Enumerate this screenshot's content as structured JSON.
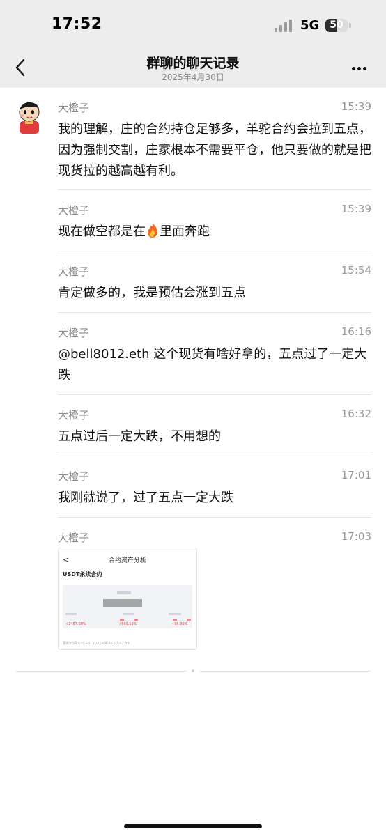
{
  "status_bar": {
    "time": "17:52",
    "network": "5G",
    "battery": "50",
    "battery_level": 0.5
  },
  "header": {
    "title": "群聊的聊天记录",
    "subtitle": "2025年4月30日"
  },
  "messages": [
    {
      "sender": "大橙子",
      "time": "15:39",
      "text": "我的理解，庄的合约持仓足够多，羊驼合约会拉到五点，因为强制交割，庄家根本不需要平仓，他只要做的就是把现货拉的越高越有利。"
    },
    {
      "sender": "大橙子",
      "time": "15:39",
      "text_before": "现在做空都是在",
      "text_after": "里面奔跑",
      "emoji": "fire-emoji"
    },
    {
      "sender": "大橙子",
      "time": "15:54",
      "text": "肯定做多的，我是预估会涨到五点"
    },
    {
      "sender": "大橙子",
      "time": "16:16",
      "text": "@bell8012.eth 这个现货有啥好拿的，五点过了一定大跌"
    },
    {
      "sender": "大橙子",
      "time": "16:32",
      "text": "五点过后一定大跌，不用想的"
    },
    {
      "sender": "大橙子",
      "time": "17:01",
      "text": "我刚就说了，过了五点一定大跌"
    },
    {
      "sender": "大橙子",
      "time": "17:03"
    }
  ],
  "screenshot": {
    "back": "<",
    "title": "合约资产分析",
    "subtitle": "USDT永续合约",
    "red1": "+2467.60%",
    "red2": "+660.50%",
    "red3": "+96.36%",
    "footer": "更新时间(UTC+8) 2025/04/30 17:02:38"
  },
  "colors": {
    "header_bg": "#ededed",
    "text": "#111111",
    "meta": "#8a8a8a",
    "separator": "#e6e6e6",
    "accent_red": "#e04040"
  },
  "icons": [
    "back-icon",
    "more-icon",
    "avatar-icon",
    "fire-emoji",
    "signal-icon",
    "battery-icon"
  ]
}
